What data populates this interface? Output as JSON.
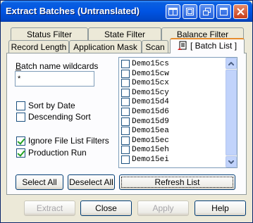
{
  "window": {
    "title": "Extract Batches (Untranslated)"
  },
  "tabs": {
    "row_back": [
      "Status Filter",
      "State Filter",
      "Balance Filter"
    ],
    "row_front": [
      "Record Length",
      "Application Mask",
      "Scan"
    ],
    "active_label": "[ Batch List ]"
  },
  "batch_panel": {
    "wildcard_label": "Batch name wildcards",
    "wildcard_value": "*",
    "sort_by_date": "Sort by Date",
    "descending_sort": "Descending Sort",
    "ignore_filters": "Ignore File List Filters",
    "production_run": "Production Run",
    "select_all": "Select All",
    "deselect_all": "Deselect All",
    "refresh_list": "Refresh List"
  },
  "batch_list": {
    "items": [
      "Demo15cs",
      "Demo15cw",
      "Demo15cx",
      "Demo15cy",
      "Demo15d4",
      "Demo15d6",
      "Demo15d9",
      "Demo15ea",
      "Demo15ec",
      "Demo15eh",
      "Demo15ei"
    ]
  },
  "footer": {
    "extract": "Extract",
    "close": "Close",
    "apply": "Apply",
    "help": "Help"
  }
}
